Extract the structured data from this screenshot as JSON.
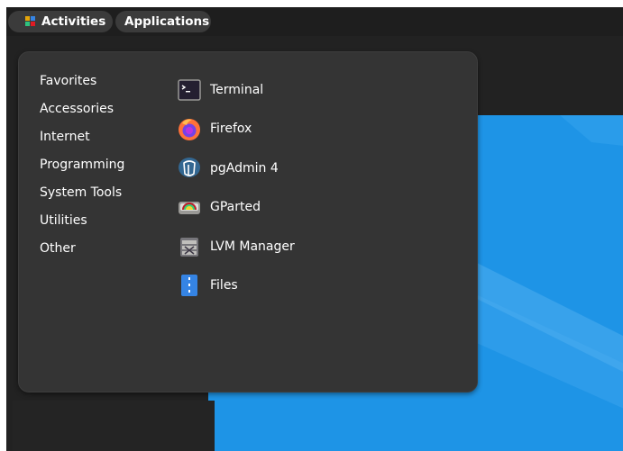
{
  "topbar": {
    "activities_label": "Activities",
    "applications_label": "Applications"
  },
  "menu": {
    "categories": [
      {
        "label": "Favorites"
      },
      {
        "label": "Accessories"
      },
      {
        "label": "Internet"
      },
      {
        "label": "Programming"
      },
      {
        "label": "System Tools"
      },
      {
        "label": "Utilities"
      },
      {
        "label": "Other"
      }
    ],
    "apps": [
      {
        "label": "Terminal",
        "icon": "terminal-icon"
      },
      {
        "label": "Firefox",
        "icon": "firefox-icon"
      },
      {
        "label": "pgAdmin 4",
        "icon": "pgadmin-icon"
      },
      {
        "label": "GParted",
        "icon": "gparted-icon"
      },
      {
        "label": "LVM Manager",
        "icon": "lvm-manager-icon"
      },
      {
        "label": "Files",
        "icon": "files-icon"
      }
    ]
  },
  "colors": {
    "panel": "#343434",
    "topbar": "#1e1e1e",
    "pill": "#3b3b3b",
    "desktop": "#1e94e6"
  }
}
